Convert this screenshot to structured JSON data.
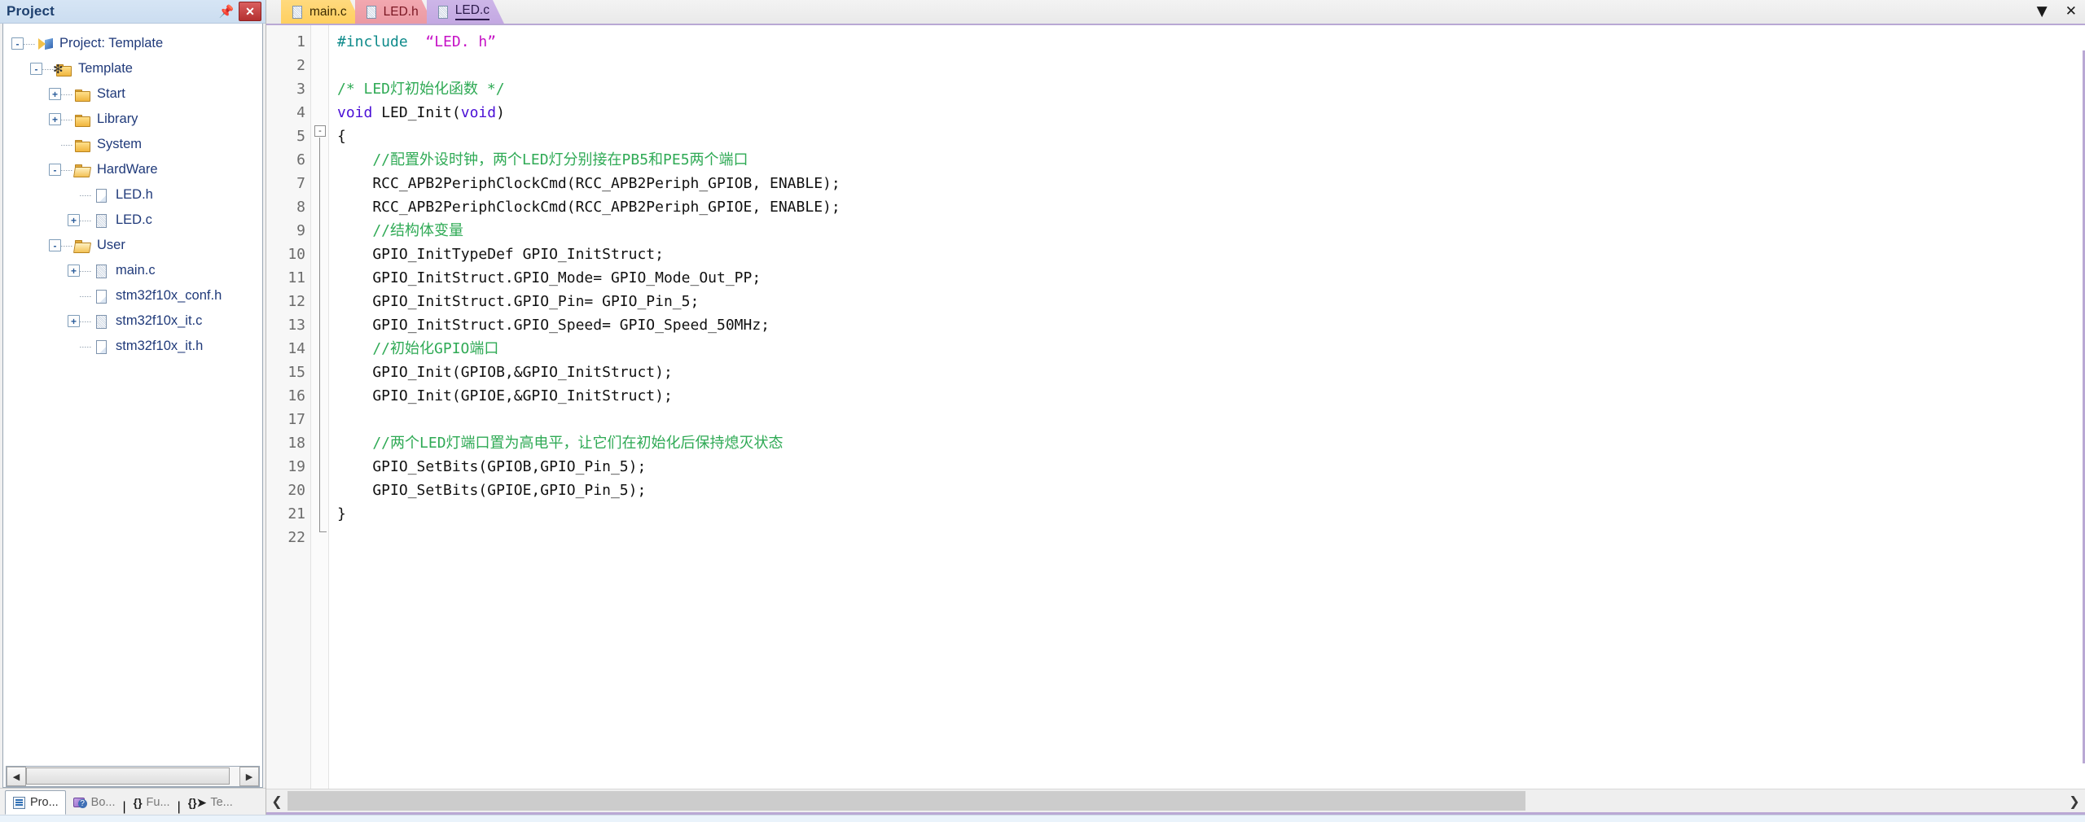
{
  "project_panel": {
    "title": "Project",
    "pin_icon": "pin-icon",
    "close_icon": "close-icon",
    "tree": [
      {
        "label": "Project: Template",
        "icon": "project-icon",
        "expander": "-",
        "depth": 0
      },
      {
        "label": "Template",
        "icon": "target-icon",
        "expander": "-",
        "depth": 1
      },
      {
        "label": "Start",
        "icon": "folder-icon",
        "expander": "+",
        "depth": 2
      },
      {
        "label": "Library",
        "icon": "folder-icon",
        "expander": "+",
        "depth": 2
      },
      {
        "label": "System",
        "icon": "folder-icon",
        "expander": "",
        "depth": 2
      },
      {
        "label": "HardWare",
        "icon": "folder-open-icon",
        "expander": "-",
        "depth": 2
      },
      {
        "label": "LED.h",
        "icon": "file-h-icon",
        "expander": "",
        "depth": 3
      },
      {
        "label": "LED.c",
        "icon": "file-c-icon",
        "expander": "+",
        "depth": 3
      },
      {
        "label": "User",
        "icon": "folder-open-icon",
        "expander": "-",
        "depth": 2
      },
      {
        "label": "main.c",
        "icon": "file-c-icon",
        "expander": "+",
        "depth": 3
      },
      {
        "label": "stm32f10x_conf.h",
        "icon": "file-h-icon",
        "expander": "",
        "depth": 3
      },
      {
        "label": "stm32f10x_it.c",
        "icon": "file-c-icon",
        "expander": "+",
        "depth": 3
      },
      {
        "label": "stm32f10x_it.h",
        "icon": "file-h-icon",
        "expander": "",
        "depth": 3
      }
    ],
    "bottom_tabs": [
      {
        "label": "Pro...",
        "icon": "project-window-icon",
        "active": true
      },
      {
        "label": "Bo...",
        "icon": "books-icon",
        "active": false
      },
      {
        "label": "Fu...",
        "icon": "functions-braces-icon",
        "active": false
      },
      {
        "label": "Te...",
        "icon": "templates-icon",
        "active": false
      }
    ]
  },
  "editor": {
    "tabs": [
      {
        "label": "main.c",
        "active": false,
        "color": "#ffd268"
      },
      {
        "label": "LED.h",
        "active": false,
        "color": "#eb99a3"
      },
      {
        "label": "LED.c",
        "active": true,
        "color": "#c3a8e2"
      }
    ],
    "window_controls": {
      "dropdown_icon": "chevron-down-icon",
      "close_icon": "close-icon"
    },
    "line_numbers": [
      "1",
      "2",
      "3",
      "4",
      "5",
      "6",
      "7",
      "8",
      "9",
      "10",
      "11",
      "12",
      "13",
      "14",
      "15",
      "16",
      "17",
      "18",
      "19",
      "20",
      "21",
      "22"
    ],
    "code_lines": [
      {
        "n": 1,
        "tokens": [
          {
            "t": "#include ",
            "c": "pp"
          },
          {
            "t": " “LED. h”",
            "c": "str"
          }
        ]
      },
      {
        "n": 2,
        "tokens": []
      },
      {
        "n": 3,
        "tokens": [
          {
            "t": "/* LED灯初始化函数 */",
            "c": "cm"
          }
        ]
      },
      {
        "n": 4,
        "tokens": [
          {
            "t": "void",
            "c": "kw"
          },
          {
            "t": " LED_Init(",
            "c": "plain"
          },
          {
            "t": "void",
            "c": "kw"
          },
          {
            "t": ")",
            "c": "plain"
          }
        ]
      },
      {
        "n": 5,
        "tokens": [
          {
            "t": "{",
            "c": "plain"
          }
        ]
      },
      {
        "n": 6,
        "tokens": [
          {
            "t": "    //配置外设时钟，两个LED灯分别接在PB5和PE5两个端口",
            "c": "cm"
          }
        ]
      },
      {
        "n": 7,
        "tokens": [
          {
            "t": "    RCC_APB2PeriphClockCmd(RCC_APB2Periph_GPIOB, ENABLE);",
            "c": "plain"
          }
        ]
      },
      {
        "n": 8,
        "tokens": [
          {
            "t": "    RCC_APB2PeriphClockCmd(RCC_APB2Periph_GPIOE, ENABLE);",
            "c": "plain"
          }
        ]
      },
      {
        "n": 9,
        "tokens": [
          {
            "t": "    //结构体变量",
            "c": "cm"
          }
        ]
      },
      {
        "n": 10,
        "tokens": [
          {
            "t": "    GPIO_InitTypeDef GPIO_InitStruct;",
            "c": "plain"
          }
        ]
      },
      {
        "n": 11,
        "tokens": [
          {
            "t": "    GPIO_InitStruct.GPIO_Mode= GPIO_Mode_Out_PP;",
            "c": "plain"
          }
        ]
      },
      {
        "n": 12,
        "tokens": [
          {
            "t": "    GPIO_InitStruct.GPIO_Pin= GPIO_Pin_5;",
            "c": "plain"
          }
        ]
      },
      {
        "n": 13,
        "tokens": [
          {
            "t": "    GPIO_InitStruct.GPIO_Speed= GPIO_Speed_50MHz;",
            "c": "plain"
          }
        ]
      },
      {
        "n": 14,
        "tokens": [
          {
            "t": "    //初始化GPIO端口",
            "c": "cm"
          }
        ]
      },
      {
        "n": 15,
        "tokens": [
          {
            "t": "    GPIO_Init(GPIOB,&GPIO_InitStruct);",
            "c": "plain"
          }
        ]
      },
      {
        "n": 16,
        "tokens": [
          {
            "t": "    GPIO_Init(GPIOE,&GPIO_InitStruct);",
            "c": "plain"
          }
        ]
      },
      {
        "n": 17,
        "tokens": []
      },
      {
        "n": 18,
        "tokens": [
          {
            "t": "    //两个LED灯端口置为高电平，让它们在初始化后保持熄灭状态",
            "c": "cm"
          }
        ]
      },
      {
        "n": 19,
        "tokens": [
          {
            "t": "    GPIO_SetBits(GPIOB,GPIO_Pin_5);",
            "c": "plain"
          }
        ]
      },
      {
        "n": 20,
        "tokens": [
          {
            "t": "    GPIO_SetBits(GPIOE,GPIO_Pin_5);",
            "c": "plain"
          }
        ]
      },
      {
        "n": 21,
        "tokens": [
          {
            "t": "}",
            "c": "plain"
          }
        ]
      },
      {
        "n": 22,
        "tokens": []
      }
    ],
    "fold_marker": "-",
    "scroll_left_icon": "chevron-left-icon",
    "scroll_right_icon": "chevron-right-icon"
  },
  "colors": {
    "tab_active": "#c3a8e2",
    "accent_border": "#b9a8d4",
    "comment": "#2faa55",
    "keyword": "#4a0fd6",
    "string": "#c612c6",
    "preprocessor": "#0d8a8a",
    "tree_text": "#203a7a",
    "panel_title": "#1d3f6e"
  }
}
